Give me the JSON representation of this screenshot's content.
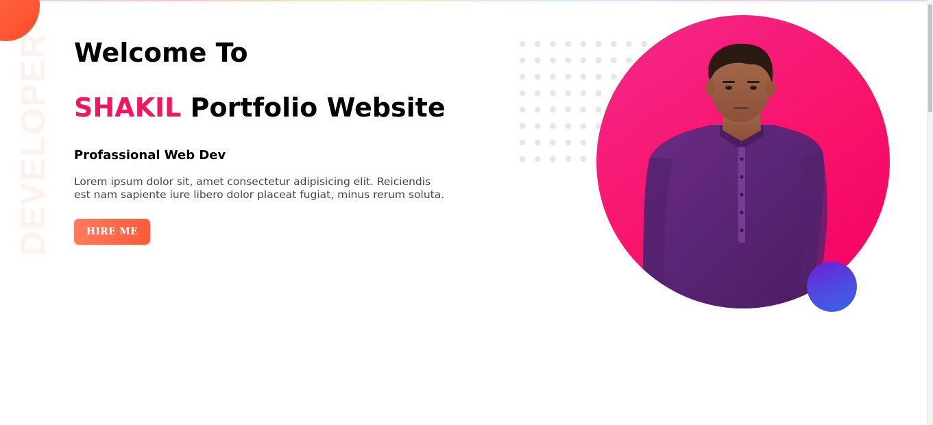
{
  "hero": {
    "vertical_word": "DEVELOPER",
    "heading_line1": "Welcome To",
    "heading_name": "SHAKIL",
    "heading_rest": " Portfolio Website",
    "subtitle": "Profassional Web Dev",
    "description": "Lorem ipsum dolor sit, amet consectetur adipisicing elit. Reiciendis est nam sapiente iure libero dolor placeat fugiat, minus rerum soluta.",
    "cta_label": "HIRE ME"
  },
  "colors": {
    "accent_pink": "#f0175f",
    "button_orange": "#ff5b3a",
    "circle_pink": "#f8136b",
    "ball_blue": "#4b4fe0",
    "shirt_purple": "#5b2676"
  },
  "icons": {
    "profile": "person-photo",
    "decoration_dots": "dot-grid",
    "decoration_corner": "corner-blob",
    "decoration_ball": "gradient-ball"
  }
}
